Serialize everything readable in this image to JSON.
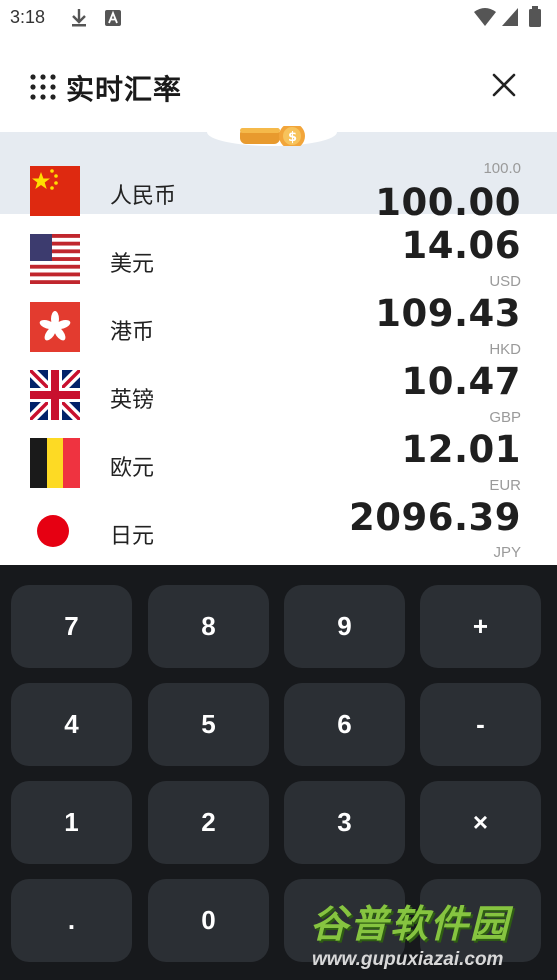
{
  "status_bar": {
    "time": "3:18",
    "icons": [
      "download-icon",
      "a-badge-icon",
      "wifi-icon",
      "signal-icon",
      "battery-icon"
    ]
  },
  "header": {
    "title": "实时汇率",
    "menu_icon": "grid-dots-icon",
    "close_icon": "close-icon"
  },
  "currencies": [
    {
      "name": "人民币",
      "amount": "100.00",
      "code": "100.0",
      "flag": "china-flag-icon",
      "selected": true
    },
    {
      "name": "美元",
      "amount": "14.06",
      "code": "USD",
      "flag": "usa-flag-icon",
      "selected": false
    },
    {
      "name": "港币",
      "amount": "109.43",
      "code": "HKD",
      "flag": "hong-kong-flag-icon",
      "selected": false
    },
    {
      "name": "英镑",
      "amount": "10.47",
      "code": "GBP",
      "flag": "uk-flag-icon",
      "selected": false
    },
    {
      "name": "欧元",
      "amount": "12.01",
      "code": "EUR",
      "flag": "belgium-flag-icon",
      "selected": false
    },
    {
      "name": "日元",
      "amount": "2096.39",
      "code": "JPY",
      "flag": "japan-flag-icon",
      "selected": false
    }
  ],
  "keypad": {
    "keys": [
      "7",
      "8",
      "9",
      "+",
      "4",
      "5",
      "6",
      "-",
      "1",
      "2",
      "3",
      "×",
      ".",
      "0",
      "",
      ""
    ]
  },
  "watermark": {
    "title": "谷普软件园",
    "url": "www.gupuxiazai.com"
  },
  "colors": {
    "selected_row": "#e6ebf1",
    "keypad_bg": "#17191c",
    "key_bg": "#2b2f34"
  }
}
